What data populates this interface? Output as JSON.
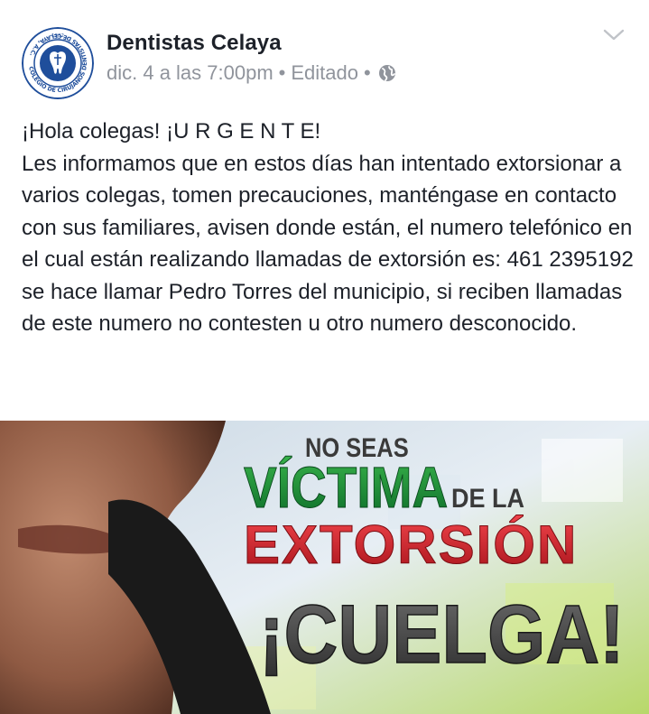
{
  "post": {
    "author": "Dentistas Celaya",
    "timestamp": "dic. 4 a las 7:00pm",
    "separator": "•",
    "edited_label": "Editado",
    "privacy_icon": "globe-icon",
    "options_icon": "chevron-down-icon",
    "avatar_logo_text": "COLEGIO DE CIRUJANOS DENTISTAS DE CELAYA, A.C.",
    "avatar_logo_year": "1982",
    "text_lines": [
      "¡Hola colegas! ¡U R G E N T E!",
      "Les informamos que en estos días han intentado extorsionar a varios colegas, tomen precauciones, manténgase en contacto con sus familiares, avisen donde están, el numero telefónico en el cual están realizando llamadas de extorsión es: 461 2395192 se hace llamar Pedro Torres del municipio, si reciben llamadas de este numero no contesten u otro numero desconocido."
    ],
    "image": {
      "line1": "NO SEAS",
      "line2_main": "VÍCTIMA",
      "line2_small": "DE LA",
      "line3": "EXTORSIÓN",
      "line4": "¡CUELGA!"
    }
  },
  "colors": {
    "name": "#1d2129",
    "meta": "#90949c",
    "logo_blue": "#1f4e9b",
    "victima_green": "#1a8f3a",
    "extorsion_red": "#d8262f"
  }
}
